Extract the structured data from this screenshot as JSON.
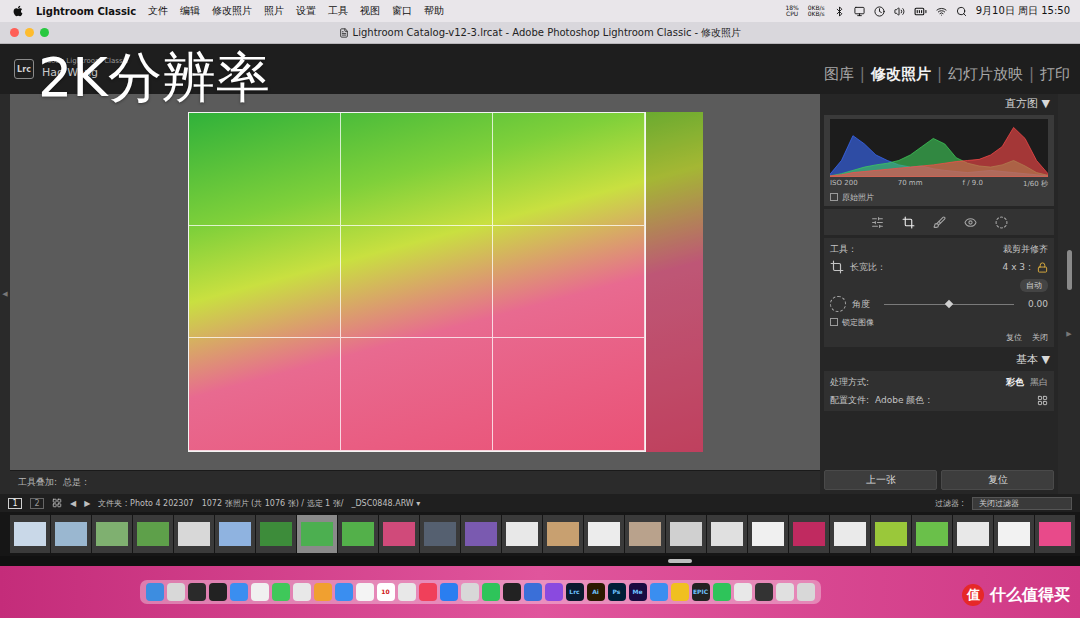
{
  "menubar": {
    "app": "Lightroom Classic",
    "menus": [
      "文件",
      "编辑",
      "修改照片",
      "照片",
      "设置",
      "工具",
      "视图",
      "窗口",
      "帮助"
    ],
    "cpu": {
      "value": "18%",
      "label": "CPU"
    },
    "network": [
      "0KB/s",
      "0KB/s"
    ],
    "clock": "9月10日 周日 15:50"
  },
  "window": {
    "title": "Lightroom Catalog-v12-3.lrcat - Adobe Photoshop Lightroom Classic - 修改照片"
  },
  "identity": {
    "logo": "Lrc",
    "product": "Adobe Lightroom Classic",
    "user": "Hao Wang"
  },
  "modules": [
    {
      "label": "图库",
      "selected": false
    },
    {
      "label": "修改照片",
      "selected": true
    },
    {
      "label": "幻灯片放映",
      "selected": false
    },
    {
      "label": "打印",
      "selected": false
    }
  ],
  "module_separator": "|",
  "edges": {
    "left": "◀",
    "right": "▶"
  },
  "canvas_toolbar": {
    "label": "工具叠加:",
    "value": "总是 :"
  },
  "histogram": {
    "title": "直方图",
    "toggle": "▼",
    "series": [
      {
        "name": "blue",
        "color": "#3a6cff",
        "values": [
          5,
          30,
          75,
          60,
          40,
          30,
          22,
          18,
          20,
          15,
          12,
          10,
          8,
          10,
          12,
          10,
          8,
          6,
          4,
          2
        ]
      },
      {
        "name": "green",
        "color": "#3fd05a",
        "values": [
          2,
          6,
          12,
          18,
          22,
          25,
          30,
          40,
          55,
          70,
          60,
          35,
          25,
          20,
          18,
          22,
          30,
          20,
          8,
          3
        ]
      },
      {
        "name": "red",
        "color": "#ff4a4a",
        "values": [
          2,
          4,
          8,
          10,
          12,
          14,
          16,
          18,
          20,
          22,
          25,
          28,
          30,
          32,
          40,
          55,
          90,
          70,
          30,
          6
        ]
      }
    ],
    "exif": [
      "ISO 200",
      "70 mm",
      "f / 9.0",
      "1/60 秒"
    ],
    "original": {
      "label": "原始照片",
      "checked": false
    }
  },
  "tool_icons": [
    {
      "name": "basic",
      "selected": false
    },
    {
      "name": "crop",
      "selected": true
    },
    {
      "name": "heal",
      "selected": false
    },
    {
      "name": "red-eye",
      "selected": false
    },
    {
      "name": "mask",
      "selected": false
    }
  ],
  "crop": {
    "tool_label": "工具：",
    "tool_value": "裁剪并修齐",
    "aspect_label": "长宽比：",
    "aspect_value": "4 x 3 :",
    "locked": true,
    "auto": "自动",
    "angle_label": "角度",
    "angle_level": 0.5,
    "angle_value": "0.00",
    "lock_image": {
      "label": "锁定图像",
      "checked": false
    },
    "buttons": [
      "复位",
      "关闭"
    ]
  },
  "basic": {
    "title": "基本",
    "toggle": "▼",
    "treatment_label": "处理方式:",
    "treatments": [
      {
        "label": "彩色",
        "selected": true
      },
      {
        "label": "黑白",
        "selected": false
      }
    ],
    "profile_label": "配置文件:",
    "profile_value": "Adobe 颜色 :"
  },
  "panel_buttons": [
    "上一张",
    "复位"
  ],
  "filmbar": {
    "views": [
      {
        "label": "1",
        "selected": true
      },
      {
        "label": "2",
        "selected": false
      }
    ],
    "nav": [
      "◀",
      "▶"
    ],
    "folder": "文件夹 : Photo 4 202307",
    "count": "1072 张照片 (共 1076 张) / 选定 1 张/",
    "file": "_DSC0848.ARW",
    "file_suffix": "▾",
    "filter_label": "过滤器 :",
    "filter_value": "关闭过滤器"
  },
  "thumbnails": [
    {
      "color": "#c9d8e8",
      "selected": false
    },
    {
      "color": "#9ab7d0",
      "selected": false
    },
    {
      "color": "#7fb070",
      "selected": false
    },
    {
      "color": "#5ea04a",
      "selected": false
    },
    {
      "color": "#d8d8d8",
      "selected": false
    },
    {
      "color": "#8fb3e0",
      "selected": false
    },
    {
      "color": "#3d8c3a",
      "selected": false
    },
    {
      "color": "#4caf50",
      "selected": true
    },
    {
      "color": "#53b04a",
      "selected": false
    },
    {
      "color": "#d04a7a",
      "selected": false
    },
    {
      "color": "#556070",
      "selected": false
    },
    {
      "color": "#7a5ab0",
      "selected": false
    },
    {
      "color": "#e8e8e8",
      "selected": false
    },
    {
      "color": "#c8a070",
      "selected": false
    },
    {
      "color": "#ececec",
      "selected": false
    },
    {
      "color": "#b9a28c",
      "selected": false
    },
    {
      "color": "#d0d0d0",
      "selected": false
    },
    {
      "color": "#e0e0e0",
      "selected": false
    },
    {
      "color": "#f0f0f0",
      "selected": false
    },
    {
      "color": "#c02a60",
      "selected": false
    },
    {
      "color": "#eaeaea",
      "selected": false
    },
    {
      "color": "#9ac83a",
      "selected": false
    },
    {
      "color": "#6ac04a",
      "selected": false
    },
    {
      "color": "#e8e8e8",
      "selected": false
    },
    {
      "color": "#f2f2f2",
      "selected": false
    },
    {
      "color": "#e84a8a",
      "selected": false
    }
  ],
  "dock": [
    {
      "color": "#3d8de0",
      "text": ""
    },
    {
      "color": "#d8d8d8",
      "text": ""
    },
    {
      "color": "#2a2a2a",
      "text": ""
    },
    {
      "color": "#222222",
      "text": ""
    },
    {
      "color": "#3a8ef0",
      "text": ""
    },
    {
      "color": "#f0f0f0",
      "text": ""
    },
    {
      "color": "#3fc85a",
      "text": ""
    },
    {
      "color": "#e8e8e8",
      "text": ""
    },
    {
      "color": "#f0a030",
      "text": ""
    },
    {
      "color": "#3a8ef0",
      "text": ""
    },
    {
      "color": "#f4f4f4",
      "text": ""
    },
    {
      "color": "#ffffff",
      "text": "10"
    },
    {
      "color": "#e8e8e8",
      "text": ""
    },
    {
      "color": "#f0405a",
      "text": ""
    },
    {
      "color": "#2a7ef0",
      "text": ""
    },
    {
      "color": "#d8d8d8",
      "text": ""
    },
    {
      "color": "#2ec45a",
      "text": ""
    },
    {
      "color": "#222222",
      "text": ""
    },
    {
      "color": "#3a6fd8",
      "text": ""
    },
    {
      "color": "#8a4adf",
      "text": ""
    },
    {
      "color": "#0a1a2e",
      "text": "Lrc"
    },
    {
      "color": "#2b1a00",
      "text": "Ai"
    },
    {
      "color": "#001e36",
      "text": "Ps"
    },
    {
      "color": "#1a0b40",
      "text": "Me"
    },
    {
      "color": "#3a8ef0",
      "text": ""
    },
    {
      "color": "#f0c020",
      "text": ""
    },
    {
      "color": "#222222",
      "text": "EPIC"
    },
    {
      "color": "#2ec45a",
      "text": ""
    },
    {
      "color": "#e8e8e8",
      "text": ""
    },
    {
      "color": "#333333",
      "text": ""
    },
    {
      "color": "#e0e0e0",
      "text": ""
    },
    {
      "color": "#d8d8d8",
      "text": ""
    }
  ],
  "overlay": {
    "caption": "2K分辨率",
    "watermark": {
      "badge": "值",
      "text": "什么值得买"
    }
  }
}
